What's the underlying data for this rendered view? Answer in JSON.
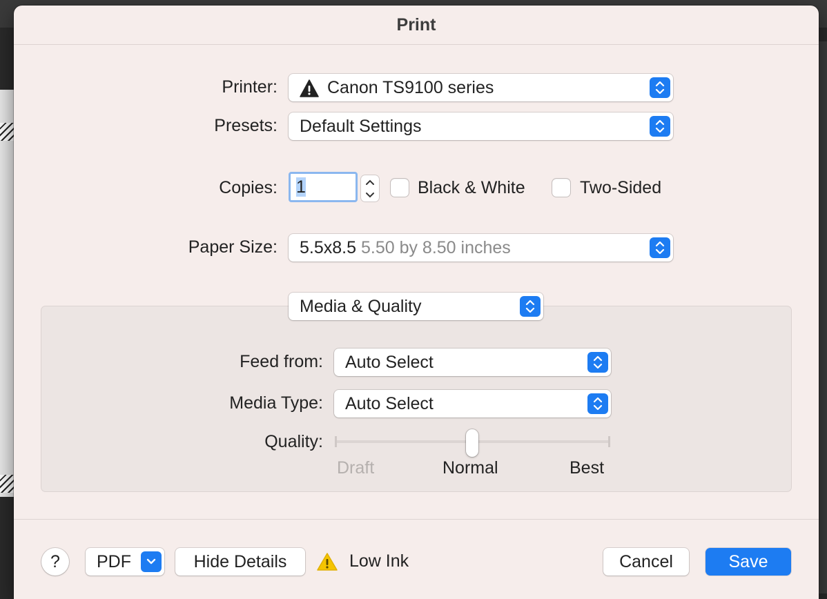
{
  "dialog": {
    "title": "Print"
  },
  "printer": {
    "label": "Printer:",
    "value": "Canon TS9100 series",
    "icon": "warning-icon"
  },
  "presets": {
    "label": "Presets:",
    "value": "Default Settings"
  },
  "copies": {
    "label": "Copies:",
    "value": "1",
    "black_white": {
      "label": "Black & White",
      "checked": false
    },
    "two_sided": {
      "label": "Two-Sided",
      "checked": false
    }
  },
  "paper_size": {
    "label": "Paper Size:",
    "value": "5.5x8.5",
    "detail": "5.50 by 8.50 inches"
  },
  "section": {
    "value": "Media & Quality"
  },
  "feed_from": {
    "label": "Feed from:",
    "value": "Auto Select"
  },
  "media_type": {
    "label": "Media Type:",
    "value": "Auto Select"
  },
  "quality": {
    "label": "Quality:",
    "levels": [
      "Draft",
      "Normal",
      "Best"
    ],
    "selected": "Normal"
  },
  "footer": {
    "help": "?",
    "pdf": "PDF",
    "hide_details": "Hide Details",
    "low_ink": "Low Ink",
    "cancel": "Cancel",
    "save": "Save"
  },
  "colors": {
    "accent": "#1d7cf2",
    "warning": "#f5c400",
    "dialog_bg": "#f6edeb"
  }
}
